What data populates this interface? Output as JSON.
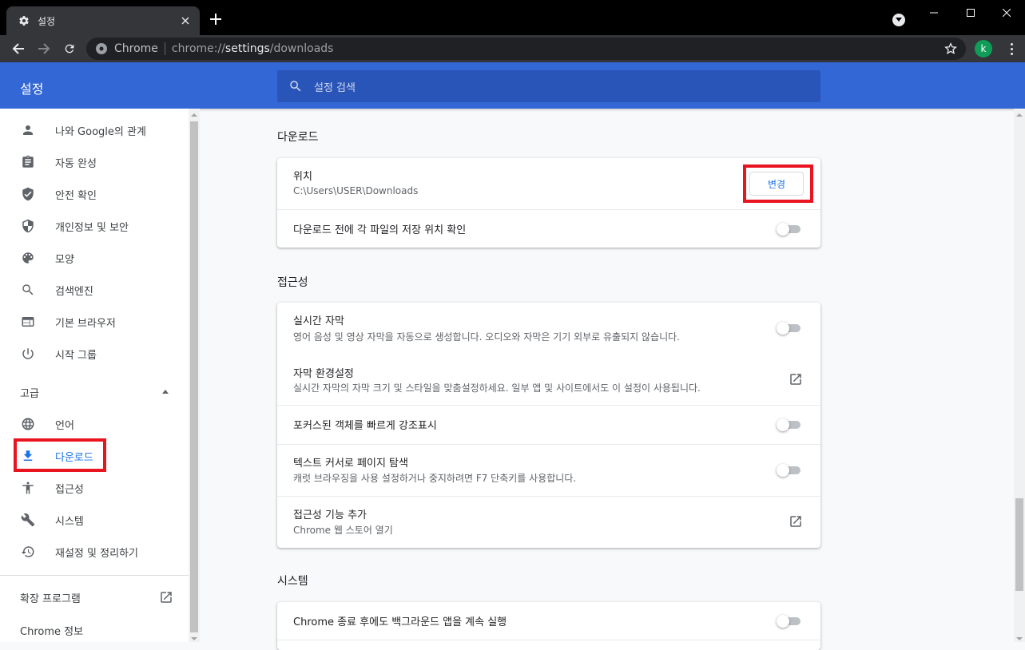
{
  "window": {
    "tab_title": "설정",
    "omnibox": {
      "site_label": "Chrome",
      "url_scheme": "chrome://",
      "url_host": "settings",
      "url_path": "/downloads"
    },
    "avatar_letter": "k"
  },
  "settings": {
    "title": "설정",
    "search_placeholder": "설정 검색"
  },
  "sidebar": {
    "items": [
      {
        "label": "나와 Google의 관계",
        "icon": "person-icon"
      },
      {
        "label": "자동 완성",
        "icon": "clipboard-icon"
      },
      {
        "label": "안전 확인",
        "icon": "shield-check-icon"
      },
      {
        "label": "개인정보 및 보안",
        "icon": "shield-half-icon"
      },
      {
        "label": "모양",
        "icon": "palette-icon"
      },
      {
        "label": "검색엔진",
        "icon": "search-icon"
      },
      {
        "label": "기본 브라우저",
        "icon": "browser-icon"
      },
      {
        "label": "시작 그룹",
        "icon": "power-icon"
      }
    ],
    "advanced_label": "고급",
    "advanced_items": [
      {
        "label": "언어",
        "icon": "globe-icon"
      },
      {
        "label": "다운로드",
        "icon": "download-icon",
        "active": true
      },
      {
        "label": "접근성",
        "icon": "accessibility-icon"
      },
      {
        "label": "시스템",
        "icon": "wrench-icon"
      },
      {
        "label": "재설정 및 정리하기",
        "icon": "history-icon"
      }
    ],
    "extensions_label": "확장 프로그램",
    "about_label": "Chrome 정보"
  },
  "main": {
    "downloads": {
      "title": "다운로드",
      "location_label": "위치",
      "location_path": "C:\\Users\\USER\\Downloads",
      "change_button": "변경",
      "ask_label": "다운로드 전에 각 파일의 저장 위치 확인",
      "ask_enabled": false
    },
    "accessibility": {
      "title": "접근성",
      "live_caption_title": "실시간 자막",
      "live_caption_sub": "영어 음성 및 영상 자막을 자동으로 생성합니다. 오디오와 자막은 기기 외부로 유출되지 않습니다.",
      "live_caption_enabled": false,
      "caption_prefs_title": "자막 환경설정",
      "caption_prefs_sub": "실시간 자막의 자막 크기 및 스타일을 맞춤설정하세요. 일부 앱 및 사이트에서도 이 설정이 사용됩니다.",
      "focus_highlight_title": "포커스된 객체를 빠르게 강조표시",
      "focus_highlight_enabled": false,
      "caret_title": "텍스트 커서로 페이지 탐색",
      "caret_sub": "캐럿 브라우징을 사용 설정하거나 중지하려면 F7 단축키를 사용합니다.",
      "caret_enabled": false,
      "add_features_title": "접근성 기능 추가",
      "add_features_sub": "Chrome 웹 스토어 열기"
    },
    "system": {
      "title": "시스템",
      "background_title": "Chrome 종료 후에도 백그라운드 앱을 계속 실행",
      "background_enabled": false
    }
  },
  "colors": {
    "header_blue": "#3367d6",
    "accent": "#1a73e8",
    "highlight_red": "#e8141f"
  }
}
